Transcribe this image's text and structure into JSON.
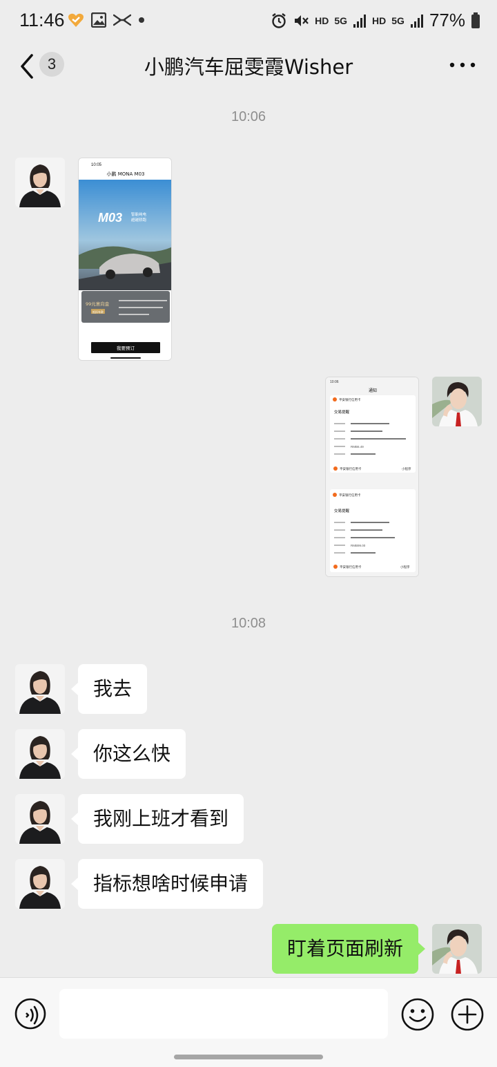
{
  "status_bar": {
    "time": "11:46",
    "battery": "77%",
    "hd1": "HD",
    "net1": "5G",
    "hd2": "HD",
    "net2": "5G"
  },
  "header": {
    "unread_count": "3",
    "title": "小鹏汽车屈雯霞Wisher"
  },
  "timestamps": [
    "10:06",
    "10:08"
  ],
  "image_messages": {
    "car_ad": {
      "time": "10:05",
      "title": "小鹏 MONA M03",
      "hero_model": "M03",
      "hero_tag1": "智能纯电",
      "hero_tag2": "超越轿跑",
      "deposit_title": "99元意向金",
      "deposit_tag": "抵扣车款",
      "button": "我要预订"
    },
    "payment_notice": {
      "time": "10:06",
      "title": "通知",
      "bank": "平安银行信用卡",
      "section_title": "交易提醒",
      "currency_1": "RMB6.49",
      "currency_2": "RMB99.00",
      "footer_bank": "平安银行信用卡",
      "footer_link": "小程序"
    }
  },
  "messages": [
    {
      "side": "left",
      "text": "我去"
    },
    {
      "side": "left",
      "text": "你这么快"
    },
    {
      "side": "left",
      "text": "我刚上班才看到"
    },
    {
      "side": "left",
      "text": "指标想啥时候申请"
    },
    {
      "side": "right",
      "text": "盯着页面刷新"
    }
  ],
  "colors": {
    "background": "#ededed",
    "bubble_self": "#95ec69",
    "bubble_other": "#ffffff",
    "header_accent": "#f26b1d"
  },
  "icons": [
    "back-icon",
    "more-icon",
    "voice-icon",
    "emoji-icon",
    "plus-icon",
    "alarm-icon",
    "mute-icon",
    "battery-icon"
  ]
}
